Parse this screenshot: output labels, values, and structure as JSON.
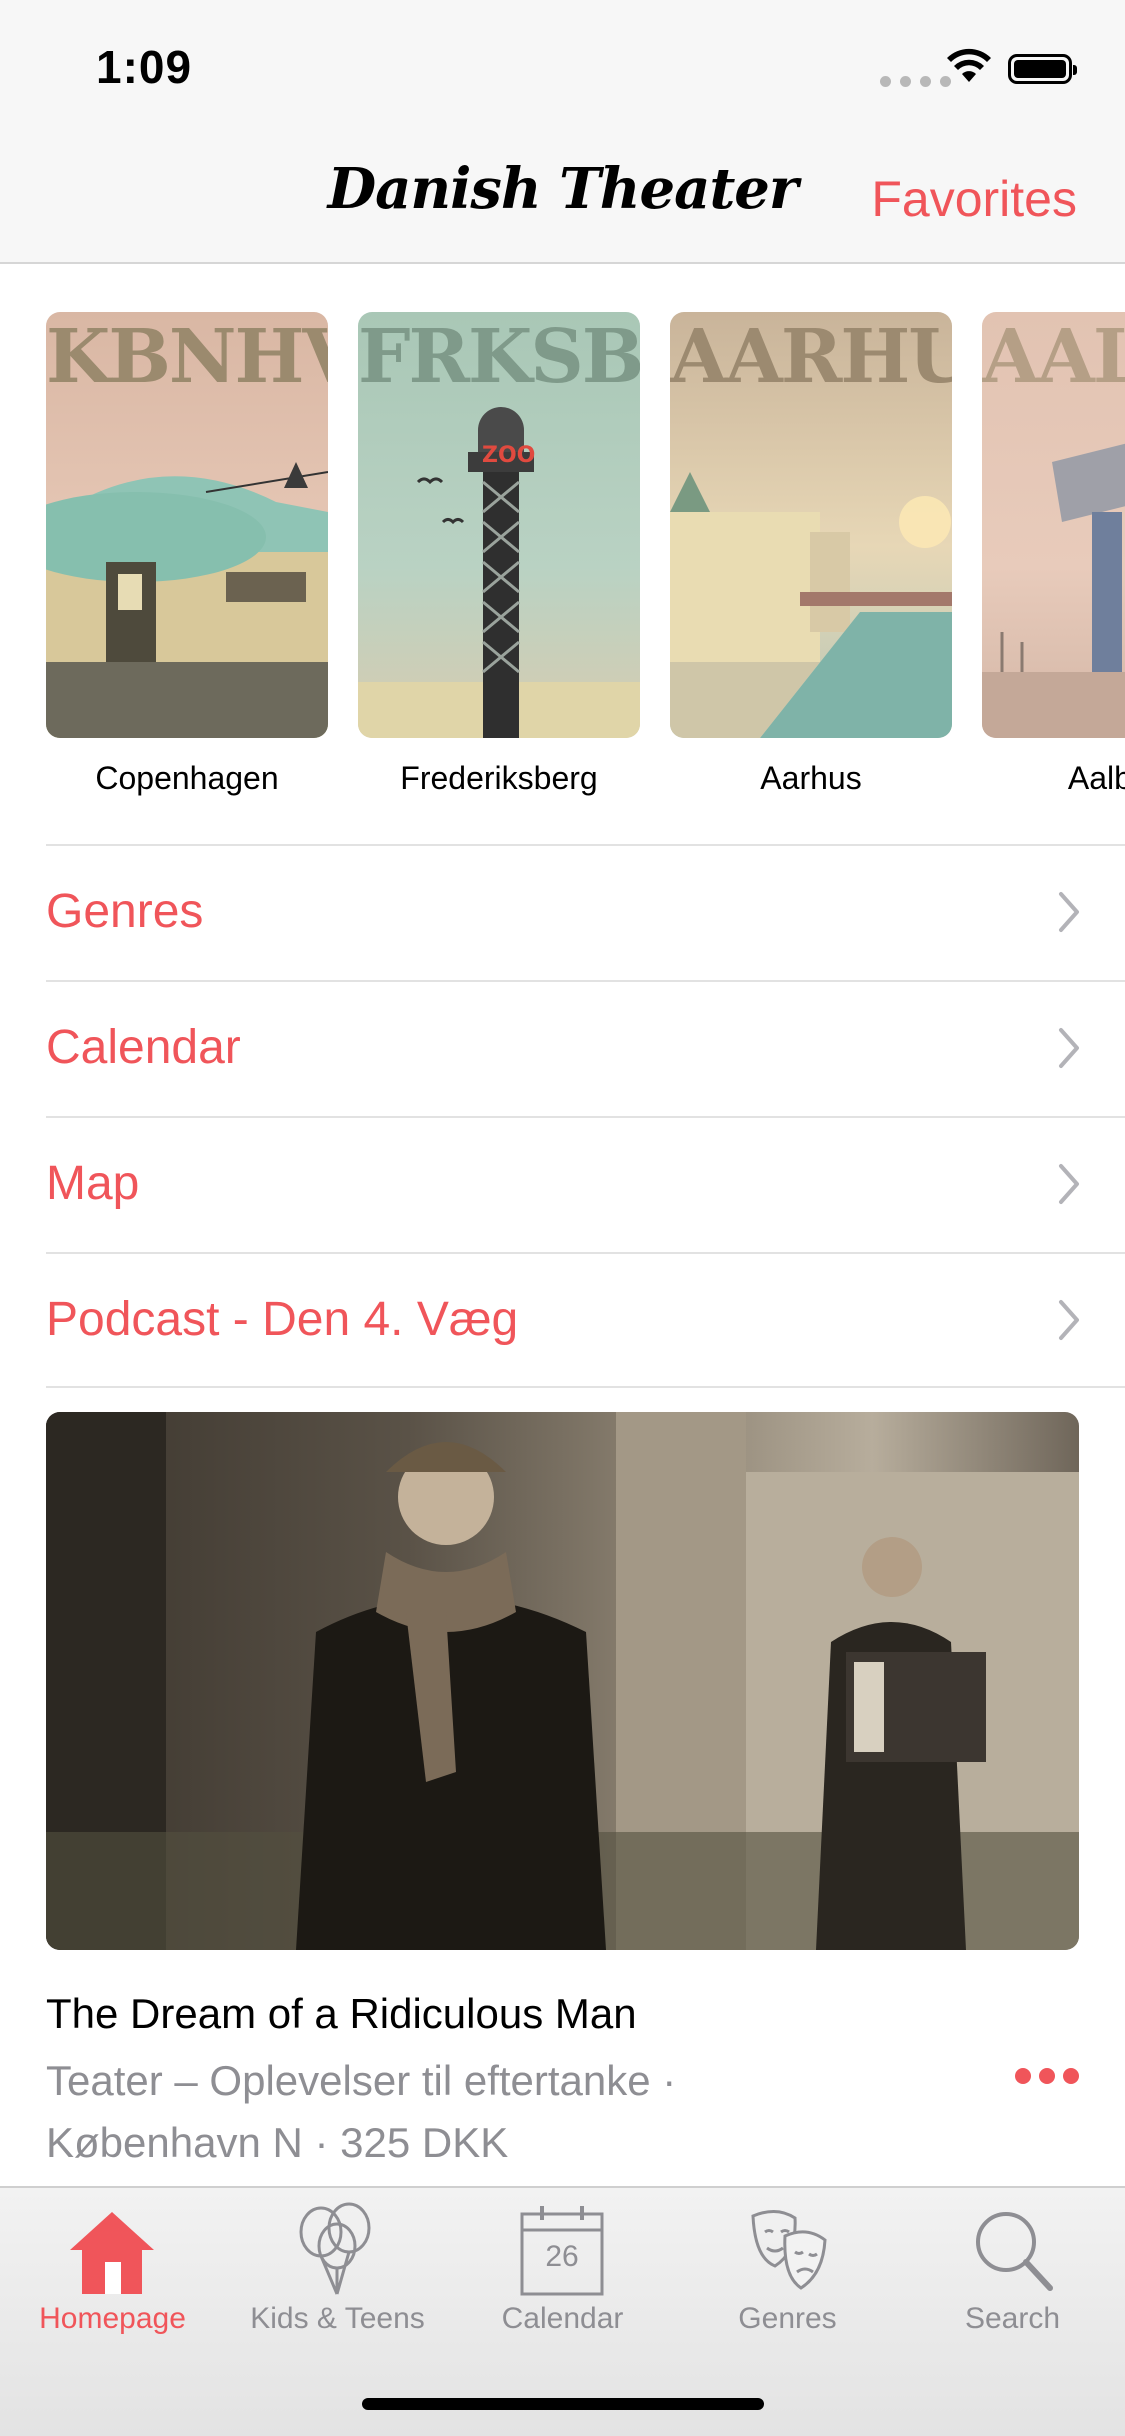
{
  "status": {
    "time": "1:09"
  },
  "nav": {
    "title": "Danish Theater",
    "favorites": "Favorites"
  },
  "cities": [
    {
      "name": "Copenhagen",
      "poster_word": "KBNHVN"
    },
    {
      "name": "Frederiksberg",
      "poster_word": "FRKSBRG"
    },
    {
      "name": "Aarhus",
      "poster_word": "AARHUS"
    },
    {
      "name": "Aalborg",
      "poster_word": "AALBORG"
    }
  ],
  "menu": [
    {
      "label": "Genres"
    },
    {
      "label": "Calendar"
    },
    {
      "label": "Map"
    },
    {
      "label": "Podcast - Den 4. Væg"
    }
  ],
  "event": {
    "title": "The Dream of a Ridiculous Man",
    "subtitle": "Teater – Oplevelser til eftertanke · København N · 325 DKK"
  },
  "tabs": [
    {
      "label": "Homepage",
      "icon": "home-icon",
      "active": true
    },
    {
      "label": "Kids & Teens",
      "icon": "balloons-icon",
      "active": false
    },
    {
      "label": "Calendar",
      "icon": "calendar-icon",
      "active": false,
      "calendar_day": "26"
    },
    {
      "label": "Genres",
      "icon": "theater-masks-icon",
      "active": false
    },
    {
      "label": "Search",
      "icon": "search-icon",
      "active": false
    }
  ],
  "colors": {
    "accent": "#f0555a",
    "secondary_text": "#8e8e93"
  }
}
